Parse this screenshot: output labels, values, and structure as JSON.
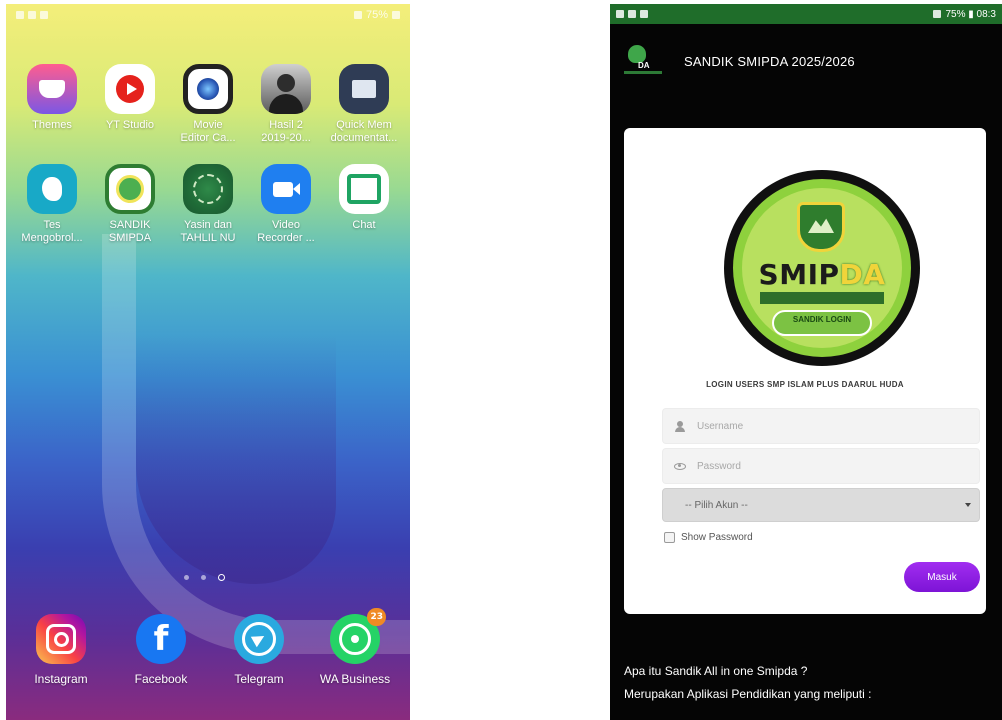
{
  "left_phone": {
    "status": {
      "right": "75%"
    },
    "apps_row1": [
      {
        "label": "Themes",
        "icon": "themes-icon"
      },
      {
        "label": "YT Studio",
        "icon": "youtube-studio-icon"
      },
      {
        "label": "Movie\nEditor Ca...",
        "icon": "camera-lens-icon"
      },
      {
        "label": "Hasil 2\n2019-20...",
        "icon": "person-photo-icon"
      },
      {
        "label": "Quick Mem\ndocumentat...",
        "icon": "document-icon"
      }
    ],
    "apps_row2": [
      {
        "label": "Tes\nMengobrol...",
        "icon": "face-icon"
      },
      {
        "label": "SANDIK\nSMIPDA",
        "icon": "sandik-logo-icon"
      },
      {
        "label": "Yasin dan\nTAHLIL NU",
        "icon": "yasin-emblem-icon"
      },
      {
        "label": "Video\nRecorder ...",
        "icon": "video-recorder-icon"
      },
      {
        "label": "Chat",
        "icon": "chat-icon"
      }
    ],
    "dock": [
      {
        "label": "Instagram",
        "icon": "instagram-icon"
      },
      {
        "label": "Facebook",
        "icon": "facebook-icon",
        "glyph": "f"
      },
      {
        "label": "Telegram",
        "icon": "telegram-icon"
      },
      {
        "label": "WA Business",
        "icon": "whatsapp-business-icon",
        "badge": "23"
      }
    ]
  },
  "right_phone": {
    "status": {
      "right": "75% ▮ 08:3"
    },
    "app_title": "SANDIK SMIPDA  2025/2026",
    "logo": {
      "text_main": "SMIP",
      "text_accent": "DA",
      "pill_title": "SANDIK LOGIN"
    },
    "login_heading": "LOGIN USERS SMP ISLAM PLUS DAARUL HUDA",
    "username_placeholder": "Username",
    "password_placeholder": "Password",
    "account_select": "-- Pilih Akun --",
    "show_password_label": "Show Password",
    "submit_label": "Masuk",
    "info_line1": "Apa itu Sandik All in one Smipda ?",
    "info_line2": "Merupakan Aplikasi Pendidikan yang meliputi :",
    "colors": {
      "status_bar": "#1f6d2a",
      "button": "#8a1fe3",
      "logo_green": "#8ed13d"
    }
  }
}
